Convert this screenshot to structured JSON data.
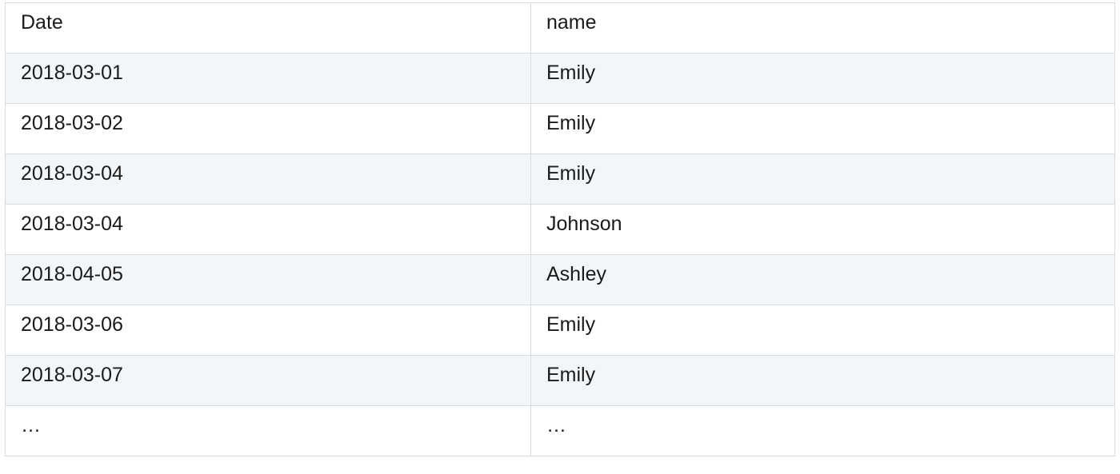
{
  "table": {
    "headers": [
      "Date",
      "name"
    ],
    "rows": [
      [
        "2018-03-01",
        "Emily"
      ],
      [
        "2018-03-02",
        "Emily"
      ],
      [
        "2018-03-04",
        "Emily"
      ],
      [
        "2018-03-04",
        "Johnson"
      ],
      [
        "2018-04-05",
        "Ashley"
      ],
      [
        "2018-03-06",
        "Emily"
      ],
      [
        "2018-03-07",
        "Emily"
      ],
      [
        "…",
        "…"
      ]
    ]
  },
  "colors": {
    "border": "#d7dce1",
    "row_shade": "#f3f6f9",
    "background": "#ffffff",
    "text": "#1a1a1a"
  }
}
